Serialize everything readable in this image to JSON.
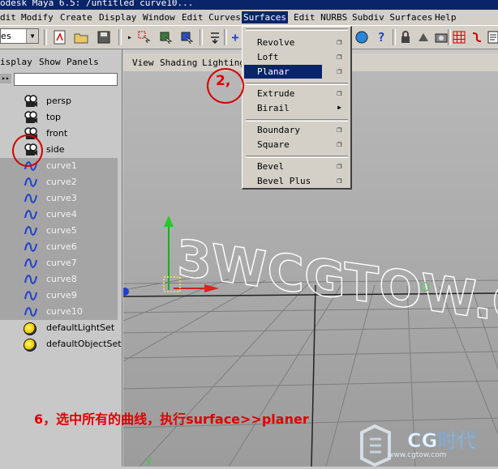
{
  "title_bar": {
    "text": "odesk Maya 6.5: /untitled      curve10..."
  },
  "menubar": {
    "items": [
      "dit",
      "Modify",
      "Create",
      "Display",
      "Window",
      "Edit Curves",
      "Surfaces",
      "Edit NURBS",
      "Subdiv Surfaces",
      "Help"
    ],
    "active": "Surfaces"
  },
  "toolbar": {
    "mode_value": "es"
  },
  "outliner": {
    "menu": [
      "isplay",
      "Show",
      "Panels"
    ],
    "items": [
      {
        "label": "persp",
        "icon": "camera-icon",
        "selected": false
      },
      {
        "label": "top",
        "icon": "camera-icon",
        "selected": false
      },
      {
        "label": "front",
        "icon": "camera-icon",
        "selected": false
      },
      {
        "label": "side",
        "icon": "camera-icon",
        "selected": false
      },
      {
        "label": "curve1",
        "icon": "curve-icon",
        "selected": true
      },
      {
        "label": "curve2",
        "icon": "curve-icon",
        "selected": true
      },
      {
        "label": "curve3",
        "icon": "curve-icon",
        "selected": true
      },
      {
        "label": "curve4",
        "icon": "curve-icon",
        "selected": true
      },
      {
        "label": "curve5",
        "icon": "curve-icon",
        "selected": true
      },
      {
        "label": "curve6",
        "icon": "curve-icon",
        "selected": true
      },
      {
        "label": "curve7",
        "icon": "curve-icon",
        "selected": true
      },
      {
        "label": "curve8",
        "icon": "curve-icon",
        "selected": true
      },
      {
        "label": "curve9",
        "icon": "curve-icon",
        "selected": true
      },
      {
        "label": "curve10",
        "icon": "curve-icon",
        "selected": true
      },
      {
        "label": "defaultLightSet",
        "icon": "light-set-icon",
        "selected": false
      },
      {
        "label": "defaultObjectSet",
        "icon": "light-set-icon",
        "selected": false
      }
    ]
  },
  "viewport": {
    "menu": [
      "View",
      "Shading",
      "Lighting"
    ],
    "scene_text": "3WCGTOW.Co",
    "axis_label": "y"
  },
  "surfaces_menu": {
    "items": [
      "Revolve",
      "Loft",
      "Planar",
      "Extrude",
      "Birail",
      "Boundary",
      "Square",
      "Bevel",
      "Bevel Plus"
    ],
    "highlighted": "Planar"
  },
  "annotations": {
    "step_marker": "2,",
    "instruction": "6，选中所有的曲线，执行surface>>planer"
  },
  "watermark": {
    "brand": "CG时代",
    "url": "www.cgtow.com"
  },
  "colors": {
    "accent": "#0a246a",
    "annotation": "#e00000",
    "selected_row": "#a5a5a5",
    "curve_icon": "#2040d0"
  }
}
